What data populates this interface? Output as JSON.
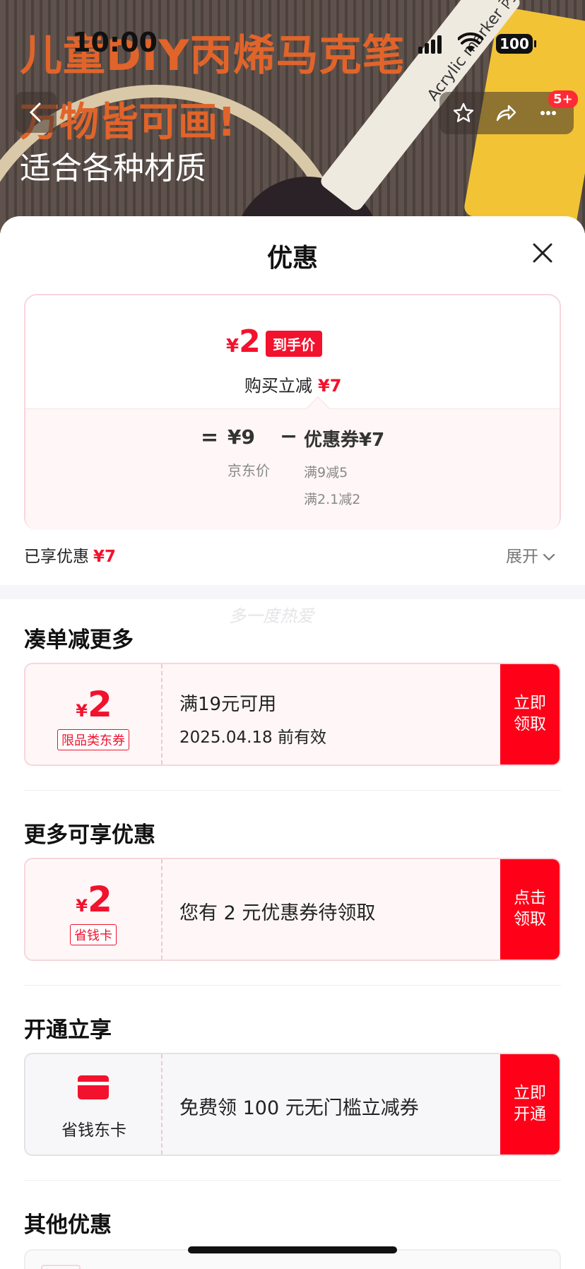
{
  "status_bar": {
    "time": "10:00",
    "battery": "100"
  },
  "product_banner": {
    "title_line1": "儿童DIY丙烯马克笔",
    "title_line2": "万物皆可画!",
    "title_line3": "适合各种材质",
    "marker_text": "Acrylic marker 丙烯"
  },
  "nav": {
    "cart_badge": "5+"
  },
  "sheet": {
    "title": "优惠",
    "price_card": {
      "currency": "¥",
      "final_price": "2",
      "final_tag": "到手价",
      "reduce_label": "购买立减",
      "reduce_amount": "¥7",
      "equals": "=",
      "jd_price": "¥9",
      "jd_label": "京东价",
      "minus": "−",
      "coupon_total": "优惠券¥7",
      "rules": [
        "满9减5",
        "满2.1减2"
      ]
    },
    "enjoyed_label": "已享优惠",
    "enjoyed_amount": "¥7",
    "expand_label": "展开",
    "watermark": "多一度热爱",
    "sections": {
      "combine": {
        "title": "凑单减更多",
        "coupon": {
          "currency": "¥",
          "amount": "2",
          "tag": "限品类东券",
          "line1": "满19元可用",
          "line2": "2025.04.18 前有效",
          "button": "立即领取"
        }
      },
      "more": {
        "title": "更多可享优惠",
        "coupon": {
          "currency": "¥",
          "amount": "2",
          "tag": "省钱卡",
          "text": "您有 2 元优惠券待领取",
          "button": "点击领取"
        }
      },
      "open": {
        "title": "开通立享",
        "card": {
          "icon": "card-icon",
          "label": "省钱东卡",
          "text": "免费领 100 元无门槛立减券",
          "button": "立即开通"
        }
      },
      "other": {
        "title": "其他优惠"
      }
    }
  },
  "colors": {
    "accent_red": "#f2122d",
    "button_red": "#fe0018",
    "coupon_bg": "#fff6f7",
    "border_pink": "#f7d6dc"
  }
}
